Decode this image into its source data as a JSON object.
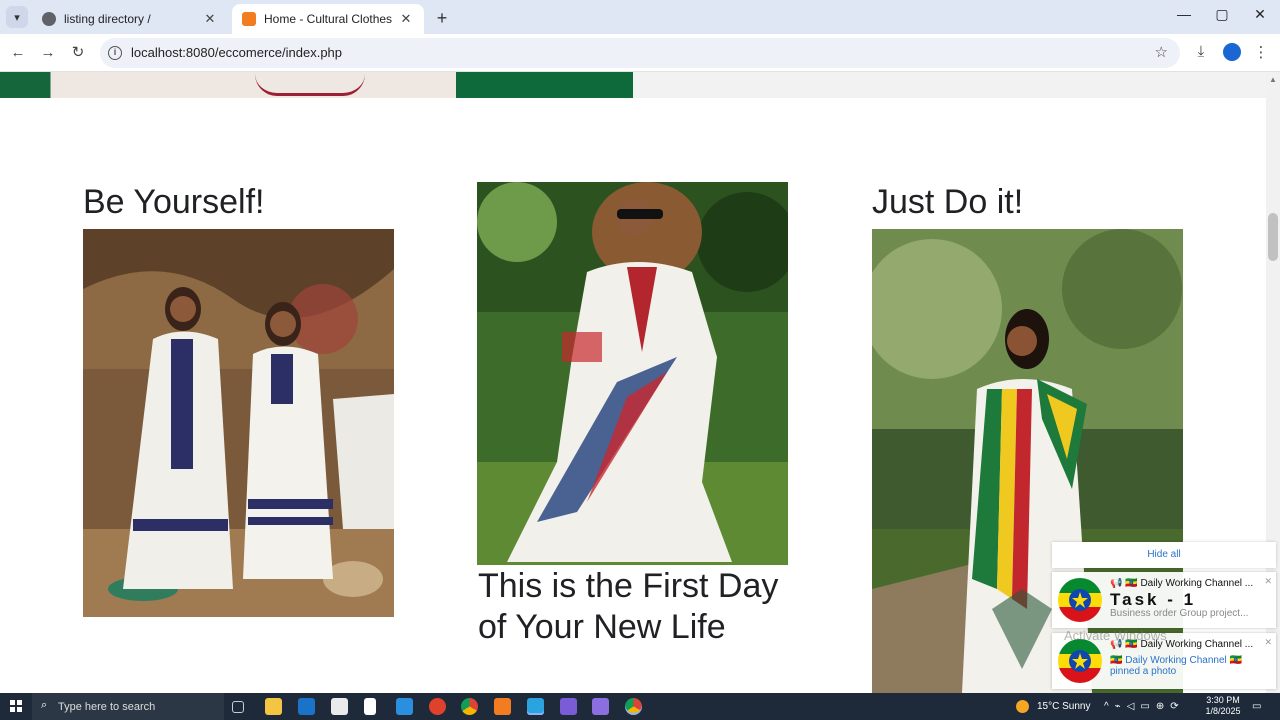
{
  "browser": {
    "tabs": [
      {
        "title": "listing directory /",
        "active": false
      },
      {
        "title": "Home - Cultural Clothes",
        "active": true
      }
    ],
    "url": "localhost:8080/eccomerce/index.php"
  },
  "page": {
    "cards": [
      {
        "title": "Be Yourself!"
      },
      {
        "title": "This is the First Day of Your New Life"
      },
      {
        "title": "Just Do it!"
      }
    ]
  },
  "notifications": {
    "hide_all": "Hide all",
    "items": [
      {
        "title": "📢 🇪🇹 Daily Working Channel ...",
        "headline": "Task - 1",
        "body": "Business order Group project..."
      },
      {
        "title": "📢 🇪🇹 Daily Working Channel ...",
        "body": "🇪🇹 Daily Working Channel 🇪🇹 pinned a photo"
      }
    ],
    "watermark": "Activate Windows"
  },
  "taskbar": {
    "search_placeholder": "Type here to search",
    "weather": "15°C  Sunny",
    "time": "3:30 PM",
    "date": "1/8/2025"
  },
  "colors": {
    "tabbar_bg": "#dfe7f5",
    "taskbar_bg": "#1e2a3a",
    "link_blue": "#2a73c9"
  }
}
